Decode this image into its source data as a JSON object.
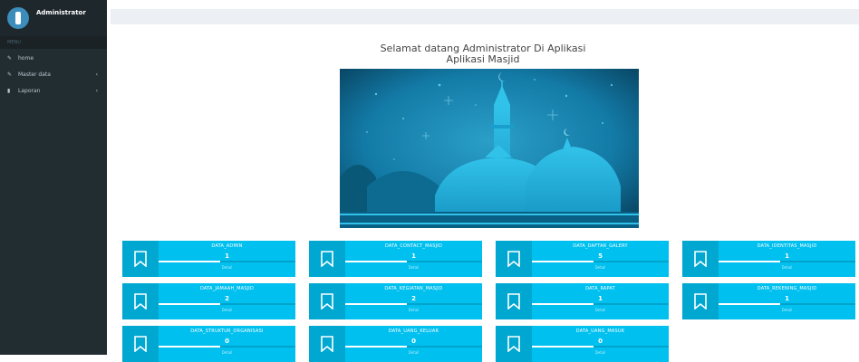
{
  "sidebar": {
    "user_name": "Administrator",
    "menu_header": "MENU",
    "items": [
      {
        "label": "home",
        "icon": "edit-icon"
      },
      {
        "label": "Master data",
        "icon": "edit-icon",
        "has_chevron": true
      },
      {
        "label": "Laporan",
        "icon": "bar-chart-icon",
        "has_chevron": true
      }
    ]
  },
  "main": {
    "welcome_line1": "Selamat datang Administrator Di Aplikasi",
    "welcome_line2": "Aplikasi Masjid"
  },
  "info_boxes": [
    {
      "title": "DATA_ADMIN",
      "count": "1",
      "detail": "Detail",
      "icon": "bookmark-icon"
    },
    {
      "title": "DATA_CONTACT_MASJID",
      "count": "1",
      "detail": "Detail",
      "icon": "bookmark-icon"
    },
    {
      "title": "DATA_DAFTAR_GALERY",
      "count": "5",
      "detail": "Detail",
      "icon": "bookmark-icon"
    },
    {
      "title": "DATA_IDENTITAS_MASJID",
      "count": "1",
      "detail": "Detail",
      "icon": "bookmark-icon"
    },
    {
      "title": "DATA_JAMAAH_MASJID",
      "count": "2",
      "detail": "Detail",
      "icon": "bookmark-icon"
    },
    {
      "title": "DATA_KEGIATAN_MASJID",
      "count": "2",
      "detail": "Detail",
      "icon": "bookmark-icon"
    },
    {
      "title": "DATA_RAPAT",
      "count": "1",
      "detail": "Detail",
      "icon": "bookmark-icon"
    },
    {
      "title": "DATA_REKENING_MASJID",
      "count": "1",
      "detail": "Detail",
      "icon": "bookmark-icon"
    },
    {
      "title": "DATA_STRUKTUR_ORGANISASI",
      "count": "0",
      "detail": "Detail",
      "icon": "bookmark-icon"
    },
    {
      "title": "DATA_UANG_KELUAR",
      "count": "0",
      "detail": "Detail",
      "icon": "bookmark-icon"
    },
    {
      "title": "DATA_UANG_MASUK",
      "count": "0",
      "detail": "Detail",
      "icon": "bookmark-icon"
    }
  ],
  "colors": {
    "sidebar_bg": "#222d32",
    "info_box_bg": "#00c0ef",
    "info_box_icon_bg": "#00a7d0",
    "hero_sky": "#0b4d6b"
  }
}
